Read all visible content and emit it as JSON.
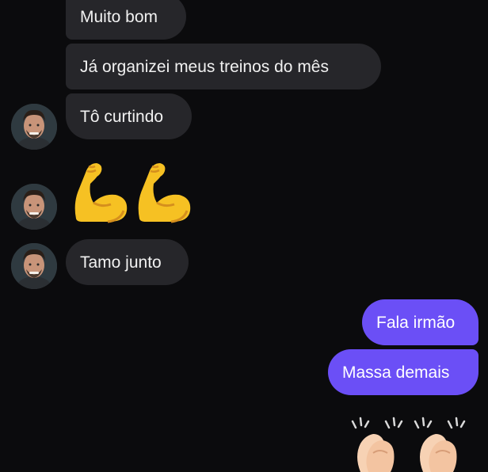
{
  "messages": {
    "incoming": [
      {
        "text": "Muito bom"
      },
      {
        "text": "Já organizei meus treinos do mês"
      },
      {
        "text": "Tô curtindo"
      },
      {
        "emoji": "flexed-biceps-emoji",
        "count": 2
      },
      {
        "text": "Tamo junto"
      }
    ],
    "outgoing": [
      {
        "text": "Fala irmão"
      },
      {
        "text": "Massa demais"
      },
      {
        "emoji": "clapping-hands-emoji",
        "count": 2
      }
    ]
  },
  "colors": {
    "background": "#0b0b0d",
    "incoming_bubble": "#26262a",
    "outgoing_bubble": "#6b4ff6",
    "text": "#ffffff"
  }
}
